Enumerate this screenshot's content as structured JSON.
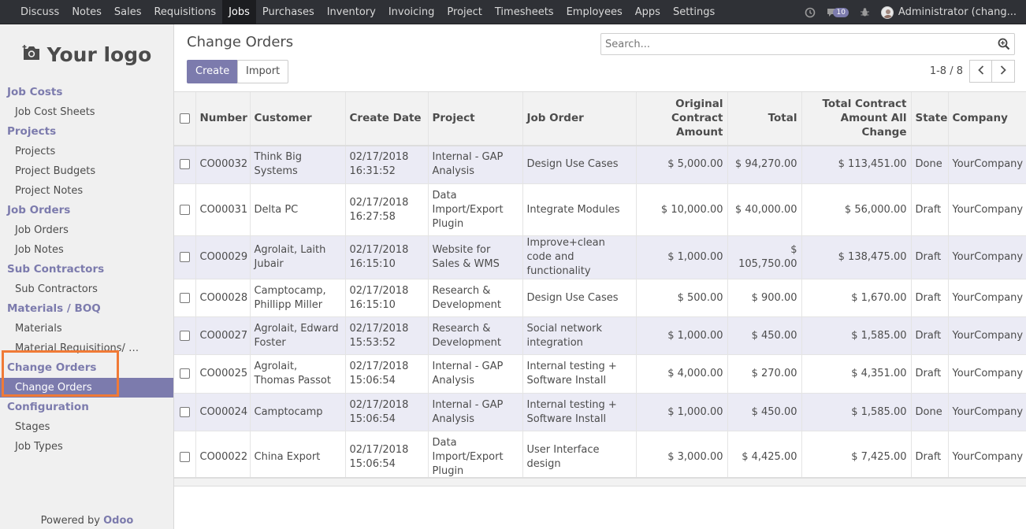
{
  "topbar": {
    "menu": [
      {
        "label": "Discuss",
        "active": false
      },
      {
        "label": "Notes",
        "active": false
      },
      {
        "label": "Sales",
        "active": false
      },
      {
        "label": "Requisitions",
        "active": false
      },
      {
        "label": "Jobs",
        "active": true
      },
      {
        "label": "Purchases",
        "active": false
      },
      {
        "label": "Inventory",
        "active": false
      },
      {
        "label": "Invoicing",
        "active": false
      },
      {
        "label": "Project",
        "active": false
      },
      {
        "label": "Timesheets",
        "active": false
      },
      {
        "label": "Employees",
        "active": false
      },
      {
        "label": "Apps",
        "active": false
      },
      {
        "label": "Settings",
        "active": false
      }
    ],
    "messages_count": "10",
    "user": "Administrator (chang..."
  },
  "sidebar": {
    "logo_text": "Your logo",
    "sections": [
      {
        "title": "Job Costs",
        "items": [
          {
            "label": "Job Cost Sheets"
          }
        ]
      },
      {
        "title": "Projects",
        "items": [
          {
            "label": "Projects"
          },
          {
            "label": "Project Budgets"
          },
          {
            "label": "Project Notes"
          }
        ]
      },
      {
        "title": "Job Orders",
        "items": [
          {
            "label": "Job Orders"
          },
          {
            "label": "Job Notes"
          }
        ]
      },
      {
        "title": "Sub Contractors",
        "items": [
          {
            "label": "Sub Contractors"
          }
        ]
      },
      {
        "title": "Materials / BOQ",
        "items": [
          {
            "label": "Materials"
          },
          {
            "label": "Material Requisitions/ BOQ"
          }
        ]
      },
      {
        "title": "Change Orders",
        "items": [
          {
            "label": "Change Orders",
            "active": true
          }
        ]
      },
      {
        "title": "Configuration",
        "items": [
          {
            "label": "Stages"
          },
          {
            "label": "Job Types"
          }
        ]
      }
    ],
    "powered_prefix": "Powered by ",
    "powered_brand": "Odoo"
  },
  "control_panel": {
    "title": "Change Orders",
    "create_label": "Create",
    "import_label": "Import",
    "search_placeholder": "Search...",
    "pager": "1-8 / 8"
  },
  "table": {
    "columns": [
      "Number",
      "Customer",
      "Create Date",
      "Project",
      "Job Order",
      "Original Contract Amount",
      "Total",
      "Total Contract Amount All Change",
      "State",
      "Company"
    ],
    "rows": [
      {
        "number": "CO00032",
        "customer": "Think Big Systems",
        "date": "02/17/2018 16:31:52",
        "project": "Internal - GAP Analysis",
        "job_order": "Design Use Cases",
        "original": "$ 5,000.00",
        "total": "$ 94,270.00",
        "total_all": "$ 113,451.00",
        "state": "Done",
        "company": "YourCompany"
      },
      {
        "number": "CO00031",
        "customer": "Delta PC",
        "date": "02/17/2018 16:27:58",
        "project": "Data Import/Export Plugin",
        "job_order": "Integrate Modules",
        "original": "$ 10,000.00",
        "total": "$ 40,000.00",
        "total_all": "$ 56,000.00",
        "state": "Draft",
        "company": "YourCompany"
      },
      {
        "number": "CO00029",
        "customer": "Agrolait, Laith Jubair",
        "date": "02/17/2018 16:15:10",
        "project": "Website for Sales & WMS",
        "job_order": "Improve+clean code and functionality",
        "original": "$ 1,000.00",
        "total": "$ 105,750.00",
        "total_all": "$ 138,475.00",
        "state": "Draft",
        "company": "YourCompany"
      },
      {
        "number": "CO00028",
        "customer": "Camptocamp, Phillipp Miller",
        "date": "02/17/2018 16:15:10",
        "project": "Research & Development",
        "job_order": "Design Use Cases",
        "original": "$ 500.00",
        "total": "$ 900.00",
        "total_all": "$ 1,670.00",
        "state": "Draft",
        "company": "YourCompany"
      },
      {
        "number": "CO00027",
        "customer": "Agrolait, Edward Foster",
        "date": "02/17/2018 15:53:52",
        "project": "Research & Development",
        "job_order": "Social network integration",
        "original": "$ 1,000.00",
        "total": "$ 450.00",
        "total_all": "$ 1,585.00",
        "state": "Draft",
        "company": "YourCompany"
      },
      {
        "number": "CO00025",
        "customer": "Agrolait, Thomas Passot",
        "date": "02/17/2018 15:06:54",
        "project": "Internal - GAP Analysis",
        "job_order": "Internal testing + Software Install",
        "original": "$ 4,000.00",
        "total": "$ 270.00",
        "total_all": "$ 4,351.00",
        "state": "Draft",
        "company": "YourCompany"
      },
      {
        "number": "CO00024",
        "customer": "Camptocamp",
        "date": "02/17/2018 15:06:54",
        "project": "Internal - GAP Analysis",
        "job_order": "Internal testing + Software Install",
        "original": "$ 1,000.00",
        "total": "$ 450.00",
        "total_all": "$ 1,585.00",
        "state": "Done",
        "company": "YourCompany"
      },
      {
        "number": "CO00022",
        "customer": "China Export",
        "date": "02/17/2018 15:06:54",
        "project": "Data Import/Export Plugin",
        "job_order": "User Interface design",
        "original": "$ 3,000.00",
        "total": "$ 4,425.00",
        "total_all": "$ 7,425.00",
        "state": "Draft",
        "company": "YourCompany"
      }
    ]
  },
  "colors": {
    "brand": "#7c7bad",
    "navbar": "#2f3136",
    "highlight": "#f07a36",
    "row_alt": "#ebebf5"
  }
}
